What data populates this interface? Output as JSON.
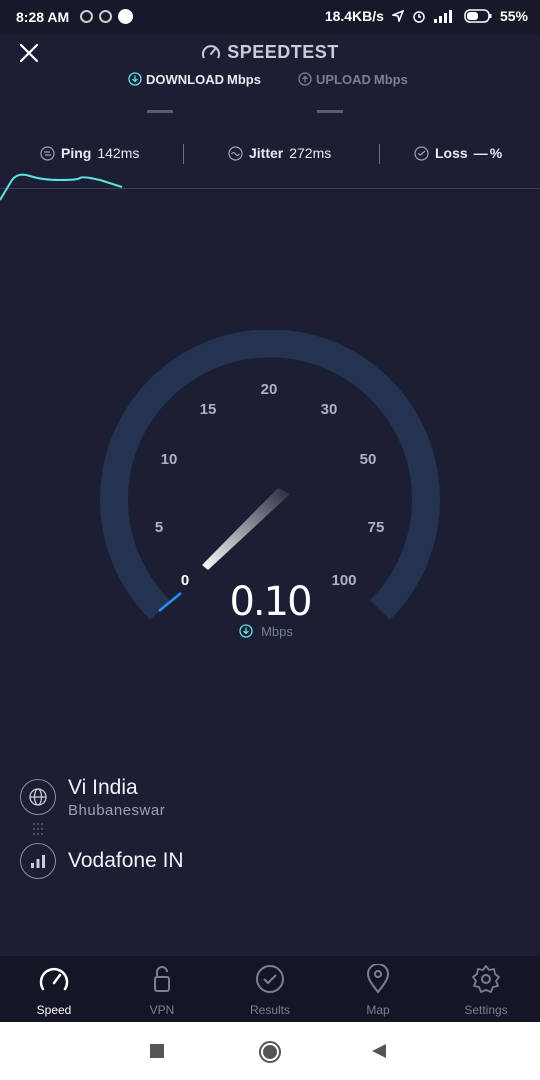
{
  "status": {
    "time": "8:28 AM",
    "net_speed": "18.4KB/s",
    "battery": "55%"
  },
  "header": {
    "title": "SPEEDTEST",
    "download_label": "DOWNLOAD",
    "upload_label": "UPLOAD",
    "unit": "Mbps"
  },
  "metrics": {
    "ping_label": "Ping",
    "ping_value": "142ms",
    "jitter_label": "Jitter",
    "jitter_value": "272ms",
    "loss_label": "Loss",
    "loss_value": "—",
    "loss_unit": "%"
  },
  "gauge": {
    "ticks": [
      "0",
      "5",
      "10",
      "15",
      "20",
      "30",
      "50",
      "75",
      "100"
    ],
    "value": "0.10",
    "unit": "Mbps",
    "current_speed": 0.1
  },
  "provider": {
    "isp": "Vi India",
    "location": "Bhubaneswar",
    "carrier": "Vodafone IN"
  },
  "nav": {
    "items": [
      {
        "label": "Speed",
        "icon": "speedometer-icon",
        "active": true
      },
      {
        "label": "VPN",
        "icon": "lock-icon",
        "active": false
      },
      {
        "label": "Results",
        "icon": "check-circle-icon",
        "active": false
      },
      {
        "label": "Map",
        "icon": "map-pin-icon",
        "active": false
      },
      {
        "label": "Settings",
        "icon": "gear-icon",
        "active": false
      }
    ]
  },
  "colors": {
    "background": "#1c1e33",
    "accent": "#5fe3e0",
    "gauge_track": "#243352",
    "progress": "#2a8fff"
  }
}
